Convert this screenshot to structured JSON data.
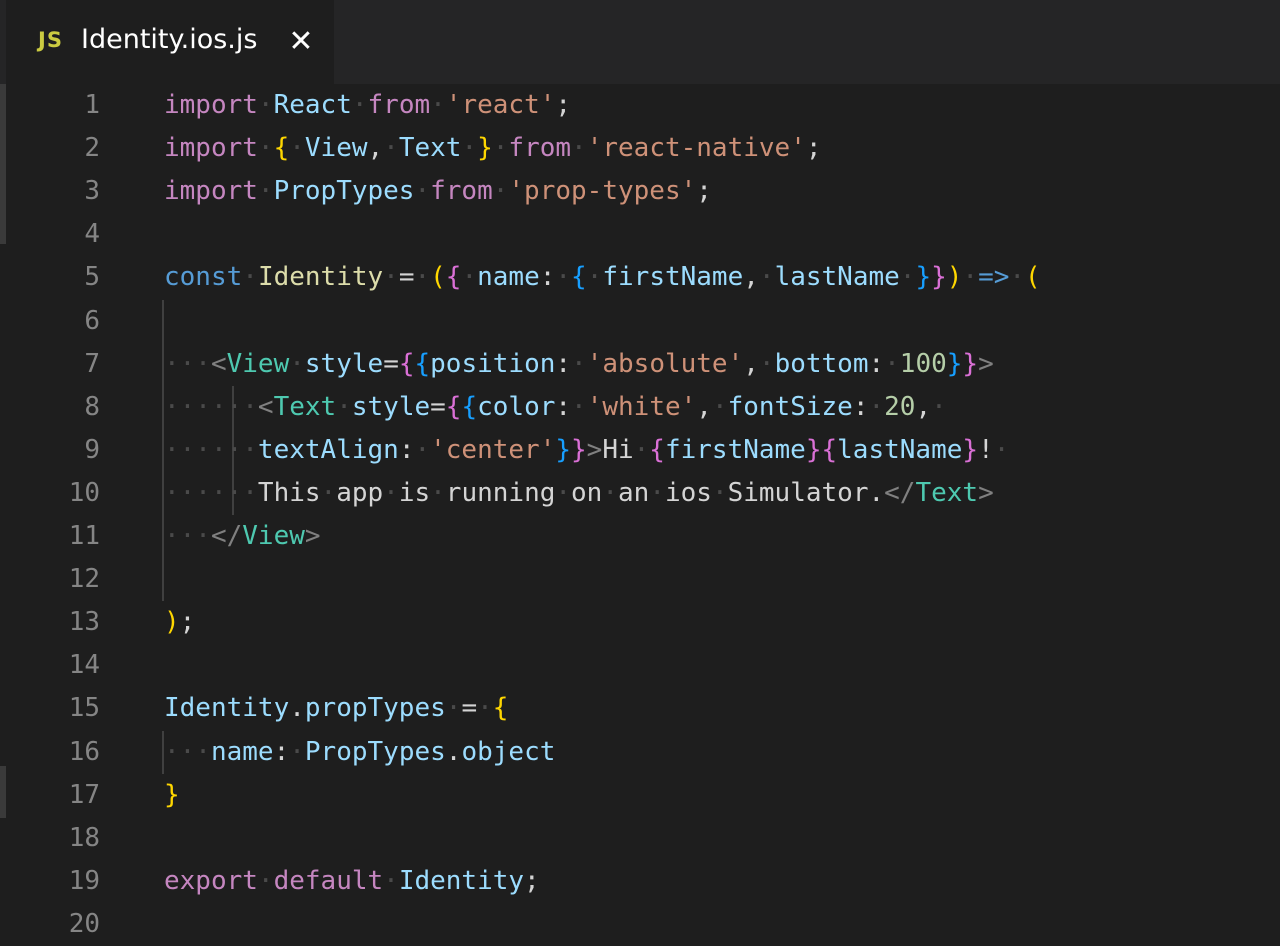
{
  "tab": {
    "icon_label": "JS",
    "title": "Identity.ios.js",
    "close_glyph": "✕"
  },
  "editor": {
    "lines": [
      {
        "n": "1",
        "tokens": [
          [
            "import",
            "kw"
          ],
          [
            "·",
            "w"
          ],
          [
            "React",
            "id"
          ],
          [
            "·",
            "w"
          ],
          [
            "from",
            "kw"
          ],
          [
            "·",
            "w"
          ],
          [
            "'react'",
            "st"
          ],
          [
            ";",
            "pn"
          ]
        ]
      },
      {
        "n": "2",
        "tokens": [
          [
            "import",
            "kw"
          ],
          [
            "·",
            "w"
          ],
          [
            "{",
            "b1"
          ],
          [
            "·",
            "w"
          ],
          [
            "View",
            "id"
          ],
          [
            ",",
            "pn"
          ],
          [
            "·",
            "w"
          ],
          [
            "Text",
            "id"
          ],
          [
            "·",
            "w"
          ],
          [
            "}",
            "b1"
          ],
          [
            "·",
            "w"
          ],
          [
            "from",
            "kw"
          ],
          [
            "·",
            "w"
          ],
          [
            "'react-native'",
            "st"
          ],
          [
            ";",
            "pn"
          ]
        ]
      },
      {
        "n": "3",
        "tokens": [
          [
            "import",
            "kw"
          ],
          [
            "·",
            "w"
          ],
          [
            "PropTypes",
            "id"
          ],
          [
            "·",
            "w"
          ],
          [
            "from",
            "kw"
          ],
          [
            "·",
            "w"
          ],
          [
            "'prop-types'",
            "st"
          ],
          [
            ";",
            "pn"
          ]
        ]
      },
      {
        "n": "4",
        "tokens": []
      },
      {
        "n": "5",
        "tokens": [
          [
            "const",
            "con"
          ],
          [
            "·",
            "w"
          ],
          [
            "Identity",
            "fn"
          ],
          [
            "·",
            "w"
          ],
          [
            "=",
            "pn"
          ],
          [
            "·",
            "w"
          ],
          [
            "(",
            "b1"
          ],
          [
            "{",
            "b2"
          ],
          [
            "·",
            "w"
          ],
          [
            "name",
            "id"
          ],
          [
            ":",
            "pn"
          ],
          [
            "·",
            "w"
          ],
          [
            "{",
            "b3"
          ],
          [
            "·",
            "w"
          ],
          [
            "firstName",
            "id"
          ],
          [
            ",",
            "pn"
          ],
          [
            "·",
            "w"
          ],
          [
            "lastName",
            "id"
          ],
          [
            "·",
            "w"
          ],
          [
            "}",
            "b3"
          ],
          [
            "}",
            "b2"
          ],
          [
            ")",
            "b1"
          ],
          [
            "·",
            "w"
          ],
          [
            "=>",
            "con"
          ],
          [
            "·",
            "w"
          ],
          [
            "(",
            "b1"
          ]
        ]
      },
      {
        "n": "6",
        "tokens": []
      },
      {
        "n": "7",
        "tokens": [
          [
            "···",
            "w"
          ],
          [
            "<",
            "ang"
          ],
          [
            "View",
            "tag"
          ],
          [
            "·",
            "w"
          ],
          [
            "style",
            "id"
          ],
          [
            "=",
            "pn"
          ],
          [
            "{",
            "b2"
          ],
          [
            "{",
            "b3"
          ],
          [
            "position",
            "id"
          ],
          [
            ":",
            "pn"
          ],
          [
            "·",
            "w"
          ],
          [
            "'absolute'",
            "st"
          ],
          [
            ",",
            "pn"
          ],
          [
            "·",
            "w"
          ],
          [
            "bottom",
            "id"
          ],
          [
            ":",
            "pn"
          ],
          [
            "·",
            "w"
          ],
          [
            "100",
            "num"
          ],
          [
            "}",
            "b3"
          ],
          [
            "}",
            "b2"
          ],
          [
            ">",
            "ang"
          ]
        ]
      },
      {
        "n": "8",
        "tokens": [
          [
            "······",
            "w"
          ],
          [
            "<",
            "ang"
          ],
          [
            "Text",
            "tag"
          ],
          [
            "·",
            "w"
          ],
          [
            "style",
            "id"
          ],
          [
            "=",
            "pn"
          ],
          [
            "{",
            "b2"
          ],
          [
            "{",
            "b3"
          ],
          [
            "color",
            "id"
          ],
          [
            ":",
            "pn"
          ],
          [
            "·",
            "w"
          ],
          [
            "'white'",
            "st"
          ],
          [
            ",",
            "pn"
          ],
          [
            "·",
            "w"
          ],
          [
            "fontSize",
            "id"
          ],
          [
            ":",
            "pn"
          ],
          [
            "·",
            "w"
          ],
          [
            "20",
            "num"
          ],
          [
            ",",
            "pn"
          ],
          [
            "·",
            "w"
          ]
        ]
      },
      {
        "n": "9",
        "tokens": [
          [
            "······",
            "w"
          ],
          [
            "textAlign",
            "id"
          ],
          [
            ":",
            "pn"
          ],
          [
            "·",
            "w"
          ],
          [
            "'center'",
            "st"
          ],
          [
            "}",
            "b3"
          ],
          [
            "}",
            "b2"
          ],
          [
            ">",
            "ang"
          ],
          [
            "Hi",
            "tx"
          ],
          [
            "·",
            "w"
          ],
          [
            "{",
            "b2"
          ],
          [
            "firstName",
            "id"
          ],
          [
            "}",
            "b2"
          ],
          [
            "{",
            "b2"
          ],
          [
            "lastName",
            "id"
          ],
          [
            "}",
            "b2"
          ],
          [
            "!",
            "tx"
          ],
          [
            "·",
            "w"
          ]
        ]
      },
      {
        "n": "10",
        "tokens": [
          [
            "······",
            "w"
          ],
          [
            "This",
            "tx"
          ],
          [
            "·",
            "w"
          ],
          [
            "app",
            "tx"
          ],
          [
            "·",
            "w"
          ],
          [
            "is",
            "tx"
          ],
          [
            "·",
            "w"
          ],
          [
            "running",
            "tx"
          ],
          [
            "·",
            "w"
          ],
          [
            "on",
            "tx"
          ],
          [
            "·",
            "w"
          ],
          [
            "an",
            "tx"
          ],
          [
            "·",
            "w"
          ],
          [
            "ios",
            "tx"
          ],
          [
            "·",
            "w"
          ],
          [
            "Simulator.",
            "tx"
          ],
          [
            "</",
            "ang"
          ],
          [
            "Text",
            "tag"
          ],
          [
            ">",
            "ang"
          ]
        ]
      },
      {
        "n": "11",
        "tokens": [
          [
            "···",
            "w"
          ],
          [
            "</",
            "ang"
          ],
          [
            "View",
            "tag"
          ],
          [
            ">",
            "ang"
          ]
        ]
      },
      {
        "n": "12",
        "tokens": []
      },
      {
        "n": "13",
        "tokens": [
          [
            ")",
            "b1"
          ],
          [
            ";",
            "pn"
          ]
        ]
      },
      {
        "n": "14",
        "tokens": []
      },
      {
        "n": "15",
        "tokens": [
          [
            "Identity",
            "id"
          ],
          [
            ".",
            "pn"
          ],
          [
            "propTypes",
            "id"
          ],
          [
            "·",
            "w"
          ],
          [
            "=",
            "pn"
          ],
          [
            "·",
            "w"
          ],
          [
            "{",
            "b1"
          ]
        ]
      },
      {
        "n": "16",
        "tokens": [
          [
            "···",
            "w"
          ],
          [
            "name",
            "id"
          ],
          [
            ":",
            "pn"
          ],
          [
            "·",
            "w"
          ],
          [
            "PropTypes",
            "id"
          ],
          [
            ".",
            "pn"
          ],
          [
            "object",
            "id"
          ]
        ]
      },
      {
        "n": "17",
        "tokens": [
          [
            "}",
            "b1"
          ]
        ]
      },
      {
        "n": "18",
        "tokens": []
      },
      {
        "n": "19",
        "tokens": [
          [
            "export",
            "kw"
          ],
          [
            "·",
            "w"
          ],
          [
            "default",
            "kw"
          ],
          [
            "·",
            "w"
          ],
          [
            "Identity",
            "id"
          ],
          [
            ";",
            "pn"
          ]
        ]
      },
      {
        "n": "20",
        "tokens": []
      }
    ]
  }
}
